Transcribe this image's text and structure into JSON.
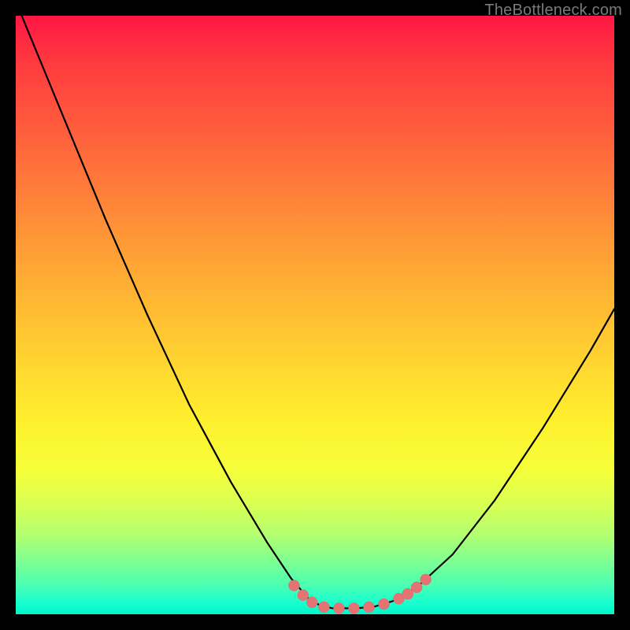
{
  "watermark": "TheBottleneck.com",
  "colors": {
    "black": "#000000",
    "marker": "#e57373",
    "gradient_top": "#ff1744",
    "gradient_mid": "#fff02d",
    "gradient_bottom": "#00f7c8"
  },
  "chart_data": {
    "type": "line",
    "title": "",
    "xlabel": "",
    "ylabel": "",
    "xlim": [
      0,
      100
    ],
    "ylim": [
      0,
      100
    ],
    "grid": false,
    "legend": false,
    "series": [
      {
        "name": "bottleneck-curve",
        "x": [
          1,
          8,
          15,
          22,
          29,
          36,
          42,
          46,
          49,
          51,
          53,
          55,
          57,
          60,
          63,
          67,
          73,
          80,
          88,
          96,
          100
        ],
        "y": [
          100,
          83,
          66,
          50,
          35,
          22,
          12,
          6,
          2.5,
          1.4,
          1.0,
          1.0,
          1.0,
          1.3,
          2.2,
          4.5,
          10,
          19,
          31,
          44,
          51
        ]
      }
    ],
    "markers": [
      {
        "x": 46.5,
        "y": 4.8
      },
      {
        "x": 48.0,
        "y": 3.2
      },
      {
        "x": 49.5,
        "y": 2.0
      },
      {
        "x": 51.5,
        "y": 1.2
      },
      {
        "x": 54.0,
        "y": 1.0
      },
      {
        "x": 56.5,
        "y": 1.0
      },
      {
        "x": 59.0,
        "y": 1.2
      },
      {
        "x": 61.5,
        "y": 1.7
      },
      {
        "x": 64.0,
        "y": 2.6
      },
      {
        "x": 65.5,
        "y": 3.4
      },
      {
        "x": 67.0,
        "y": 4.5
      },
      {
        "x": 68.5,
        "y": 5.8
      }
    ],
    "marker_radius": 7
  }
}
